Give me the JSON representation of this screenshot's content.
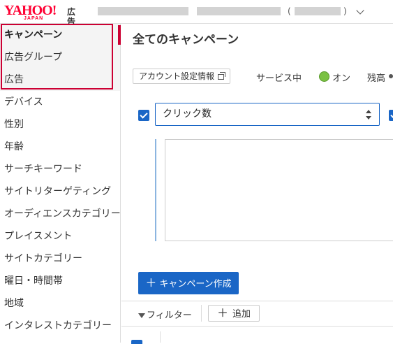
{
  "header": {
    "logo_text": "YAHOO!",
    "logo_sub": "JAPAN",
    "ad_label": "広告",
    "account_paren_open": "(",
    "account_paren_close": ")"
  },
  "sidebar": {
    "items": [
      {
        "label": "キャンペーン",
        "selected": true
      },
      {
        "label": "広告グループ"
      },
      {
        "label": "広告"
      },
      {
        "label": "デバイス"
      },
      {
        "label": "性別"
      },
      {
        "label": "年齢"
      },
      {
        "label": "サーチキーワード"
      },
      {
        "label": "サイトリターゲティング"
      },
      {
        "label": "オーディエンスカテゴリー"
      },
      {
        "label": "プレイスメント"
      },
      {
        "label": "サイトカテゴリー"
      },
      {
        "label": "曜日・時間帯"
      },
      {
        "label": "地域"
      },
      {
        "label": "インタレストカテゴリー"
      }
    ]
  },
  "main": {
    "title": "全てのキャンペーン",
    "account_settings_button": "アカウント設定情報",
    "service_label": "サービス中",
    "status_on": "オン",
    "budget_label": "残高",
    "metric_select_value": "クリック数",
    "create_button": "キャンペーン作成",
    "filter_label": "フィルター",
    "add_button": "追加"
  },
  "colors": {
    "brand_red": "#ff0033",
    "highlight_red": "#cc0033",
    "primary_blue": "#1a66c6",
    "status_green": "#7ac143"
  }
}
